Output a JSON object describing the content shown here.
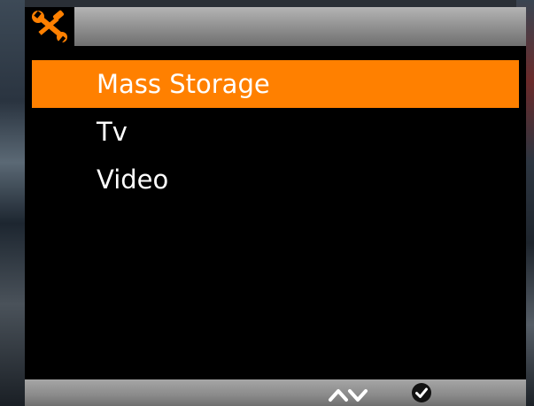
{
  "header": {
    "settings_icon": "wrench-screwdriver-icon"
  },
  "menu": {
    "items": [
      {
        "label": "Mass Storage",
        "selected": true
      },
      {
        "label": "Tv",
        "selected": false
      },
      {
        "label": "Video",
        "selected": false
      }
    ]
  },
  "footer": {
    "nav_icon": "up-down-chevrons-icon",
    "confirm_icon": "check-circle-icon"
  },
  "colors": {
    "highlight": "#ff8000",
    "menu_background": "#000000",
    "text": "#ffffff"
  }
}
